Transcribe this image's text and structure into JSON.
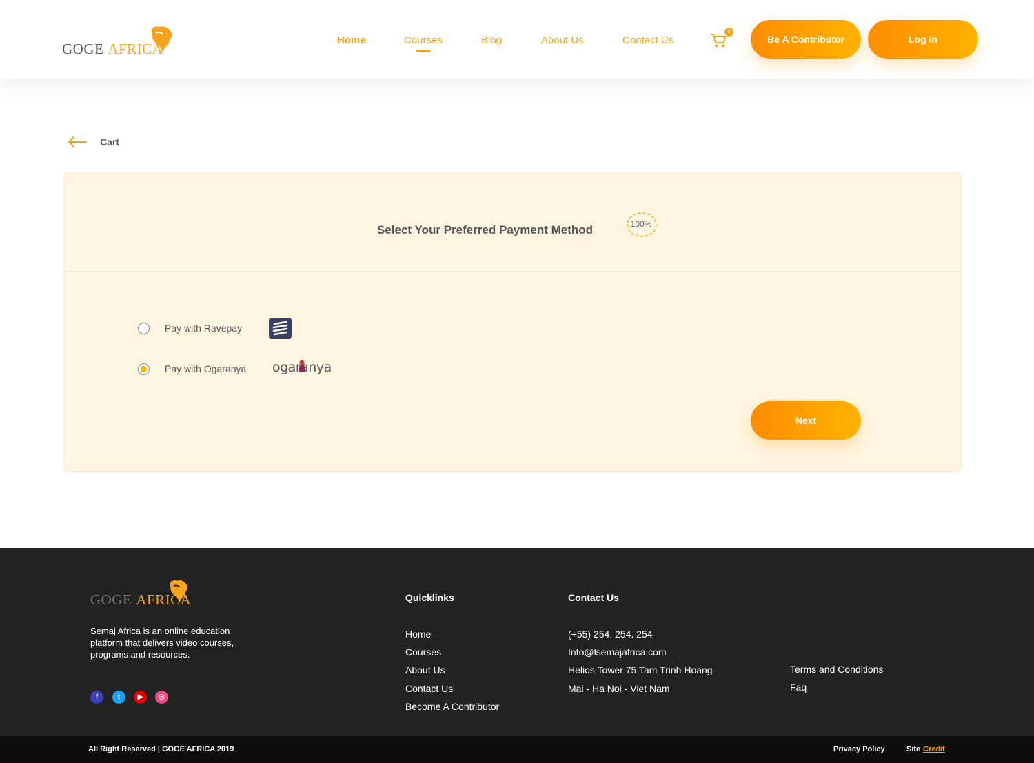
{
  "brand": {
    "name_part1": "GOGE",
    "name_part2": "AFRICA",
    "accent_color": "#f7a21b",
    "logo_icon": "africa-map-head-icon"
  },
  "nav": {
    "items": [
      {
        "label": "Home",
        "active": true
      },
      {
        "label": "Courses",
        "active": false,
        "underlined": true
      },
      {
        "label": "Blog",
        "active": false
      },
      {
        "label": "About Us",
        "active": false
      },
      {
        "label": "Contact Us",
        "active": false
      }
    ],
    "cart_icon": "cart-icon",
    "cart_count": "0",
    "contributor_button": "Be A Contributor",
    "login_button": "Log in"
  },
  "back": {
    "icon": "arrow-left-icon",
    "label": "Cart"
  },
  "payment": {
    "title": "Select Your Preferred Payment Method",
    "progress_label": "100%",
    "progress_value": 1.0,
    "options": [
      {
        "label": "Pay with Ravepay",
        "selected": false,
        "logo": "ravepay-logo"
      },
      {
        "label": "Pay with Ogaranya",
        "selected": true,
        "logo_text": "ogaranya"
      }
    ],
    "next_button": "Next"
  },
  "footer": {
    "description": "Semaj Africa is an online education platform that delivers video courses, programs and resources.",
    "social": [
      "facebook-icon",
      "twitter-icon",
      "youtube-icon",
      "dribbble-icon"
    ],
    "quicklinks_title": "Quicklinks",
    "quicklinks": [
      "Home",
      "Courses",
      "About Us",
      "Contact Us",
      "Become A Contributor"
    ],
    "contact_title": "Contact Us",
    "contact": [
      "(+55) 254. 254. 254",
      "Info@lsemajafrica.com",
      "Helios Tower 75 Tam Trinh Hoang",
      "Mai - Ha Noi - Viet Nam"
    ],
    "legal_links": [
      "Terms and Conditions",
      "Faq"
    ]
  },
  "bottom": {
    "copyright": "All Right Reserved | GOGE AFRICA 2019",
    "privacy": "Privacy Policy",
    "site": "Site",
    "credit": "Credit"
  }
}
